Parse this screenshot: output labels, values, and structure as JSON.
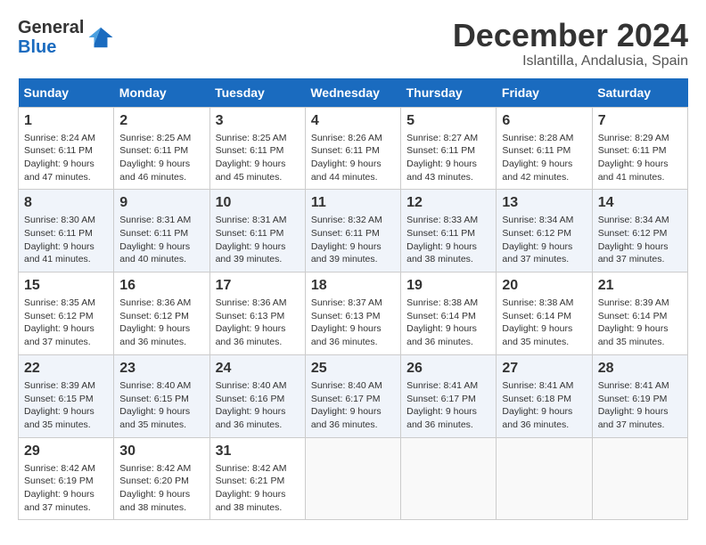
{
  "logo": {
    "general": "General",
    "blue": "Blue"
  },
  "title": "December 2024",
  "location": "Islantilla, Andalusia, Spain",
  "days_of_week": [
    "Sunday",
    "Monday",
    "Tuesday",
    "Wednesday",
    "Thursday",
    "Friday",
    "Saturday"
  ],
  "weeks": [
    [
      {
        "day": "1",
        "sunrise": "8:24 AM",
        "sunset": "6:11 PM",
        "daylight": "9 hours and 47 minutes."
      },
      {
        "day": "2",
        "sunrise": "8:25 AM",
        "sunset": "6:11 PM",
        "daylight": "9 hours and 46 minutes."
      },
      {
        "day": "3",
        "sunrise": "8:25 AM",
        "sunset": "6:11 PM",
        "daylight": "9 hours and 45 minutes."
      },
      {
        "day": "4",
        "sunrise": "8:26 AM",
        "sunset": "6:11 PM",
        "daylight": "9 hours and 44 minutes."
      },
      {
        "day": "5",
        "sunrise": "8:27 AM",
        "sunset": "6:11 PM",
        "daylight": "9 hours and 43 minutes."
      },
      {
        "day": "6",
        "sunrise": "8:28 AM",
        "sunset": "6:11 PM",
        "daylight": "9 hours and 42 minutes."
      },
      {
        "day": "7",
        "sunrise": "8:29 AM",
        "sunset": "6:11 PM",
        "daylight": "9 hours and 41 minutes."
      }
    ],
    [
      {
        "day": "8",
        "sunrise": "8:30 AM",
        "sunset": "6:11 PM",
        "daylight": "9 hours and 41 minutes."
      },
      {
        "day": "9",
        "sunrise": "8:31 AM",
        "sunset": "6:11 PM",
        "daylight": "9 hours and 40 minutes."
      },
      {
        "day": "10",
        "sunrise": "8:31 AM",
        "sunset": "6:11 PM",
        "daylight": "9 hours and 39 minutes."
      },
      {
        "day": "11",
        "sunrise": "8:32 AM",
        "sunset": "6:11 PM",
        "daylight": "9 hours and 39 minutes."
      },
      {
        "day": "12",
        "sunrise": "8:33 AM",
        "sunset": "6:11 PM",
        "daylight": "9 hours and 38 minutes."
      },
      {
        "day": "13",
        "sunrise": "8:34 AM",
        "sunset": "6:12 PM",
        "daylight": "9 hours and 37 minutes."
      },
      {
        "day": "14",
        "sunrise": "8:34 AM",
        "sunset": "6:12 PM",
        "daylight": "9 hours and 37 minutes."
      }
    ],
    [
      {
        "day": "15",
        "sunrise": "8:35 AM",
        "sunset": "6:12 PM",
        "daylight": "9 hours and 37 minutes."
      },
      {
        "day": "16",
        "sunrise": "8:36 AM",
        "sunset": "6:12 PM",
        "daylight": "9 hours and 36 minutes."
      },
      {
        "day": "17",
        "sunrise": "8:36 AM",
        "sunset": "6:13 PM",
        "daylight": "9 hours and 36 minutes."
      },
      {
        "day": "18",
        "sunrise": "8:37 AM",
        "sunset": "6:13 PM",
        "daylight": "9 hours and 36 minutes."
      },
      {
        "day": "19",
        "sunrise": "8:38 AM",
        "sunset": "6:14 PM",
        "daylight": "9 hours and 36 minutes."
      },
      {
        "day": "20",
        "sunrise": "8:38 AM",
        "sunset": "6:14 PM",
        "daylight": "9 hours and 35 minutes."
      },
      {
        "day": "21",
        "sunrise": "8:39 AM",
        "sunset": "6:14 PM",
        "daylight": "9 hours and 35 minutes."
      }
    ],
    [
      {
        "day": "22",
        "sunrise": "8:39 AM",
        "sunset": "6:15 PM",
        "daylight": "9 hours and 35 minutes."
      },
      {
        "day": "23",
        "sunrise": "8:40 AM",
        "sunset": "6:15 PM",
        "daylight": "9 hours and 35 minutes."
      },
      {
        "day": "24",
        "sunrise": "8:40 AM",
        "sunset": "6:16 PM",
        "daylight": "9 hours and 36 minutes."
      },
      {
        "day": "25",
        "sunrise": "8:40 AM",
        "sunset": "6:17 PM",
        "daylight": "9 hours and 36 minutes."
      },
      {
        "day": "26",
        "sunrise": "8:41 AM",
        "sunset": "6:17 PM",
        "daylight": "9 hours and 36 minutes."
      },
      {
        "day": "27",
        "sunrise": "8:41 AM",
        "sunset": "6:18 PM",
        "daylight": "9 hours and 36 minutes."
      },
      {
        "day": "28",
        "sunrise": "8:41 AM",
        "sunset": "6:19 PM",
        "daylight": "9 hours and 37 minutes."
      }
    ],
    [
      {
        "day": "29",
        "sunrise": "8:42 AM",
        "sunset": "6:19 PM",
        "daylight": "9 hours and 37 minutes."
      },
      {
        "day": "30",
        "sunrise": "8:42 AM",
        "sunset": "6:20 PM",
        "daylight": "9 hours and 38 minutes."
      },
      {
        "day": "31",
        "sunrise": "8:42 AM",
        "sunset": "6:21 PM",
        "daylight": "9 hours and 38 minutes."
      },
      null,
      null,
      null,
      null
    ]
  ]
}
